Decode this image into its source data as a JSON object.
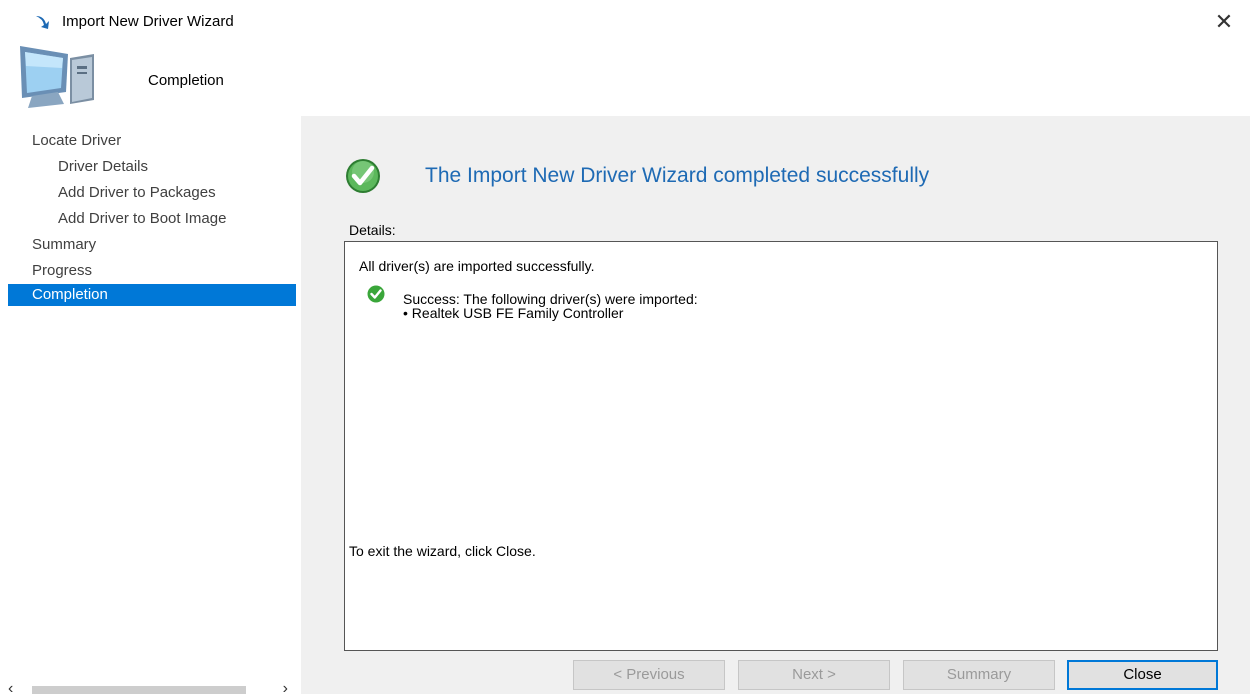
{
  "window": {
    "title": "Import New Driver Wizard",
    "close_glyph": "✕"
  },
  "header": {
    "title": "Completion",
    "icon": "computer-icon"
  },
  "sidebar": {
    "items": [
      {
        "label": "Locate Driver",
        "level": 0,
        "active": false
      },
      {
        "label": "Driver Details",
        "level": 1,
        "active": false
      },
      {
        "label": "Add Driver to Packages",
        "level": 1,
        "active": false
      },
      {
        "label": "Add Driver to Boot Image",
        "level": 1,
        "active": false
      },
      {
        "label": "Summary",
        "level": 0,
        "active": false
      },
      {
        "label": "Progress",
        "level": 0,
        "active": false
      },
      {
        "label": "Completion",
        "level": 0,
        "active": true
      }
    ]
  },
  "main": {
    "heading": "The Import New Driver Wizard completed successfully",
    "details_label": "Details:",
    "details": {
      "line1": "All driver(s) are imported successfully.",
      "success_text": "Success: The following driver(s) were imported:",
      "drivers": [
        "• Realtek USB FE Family Controller"
      ]
    },
    "exit_text": "To exit the wizard, click Close."
  },
  "buttons": {
    "previous": "< Previous",
    "next": "Next >",
    "summary": "Summary",
    "close": "Close"
  },
  "colors": {
    "accent": "#0078d7",
    "heading": "#1e6ab4",
    "panel": "#f0f0f0",
    "success": "#3aa63a"
  }
}
